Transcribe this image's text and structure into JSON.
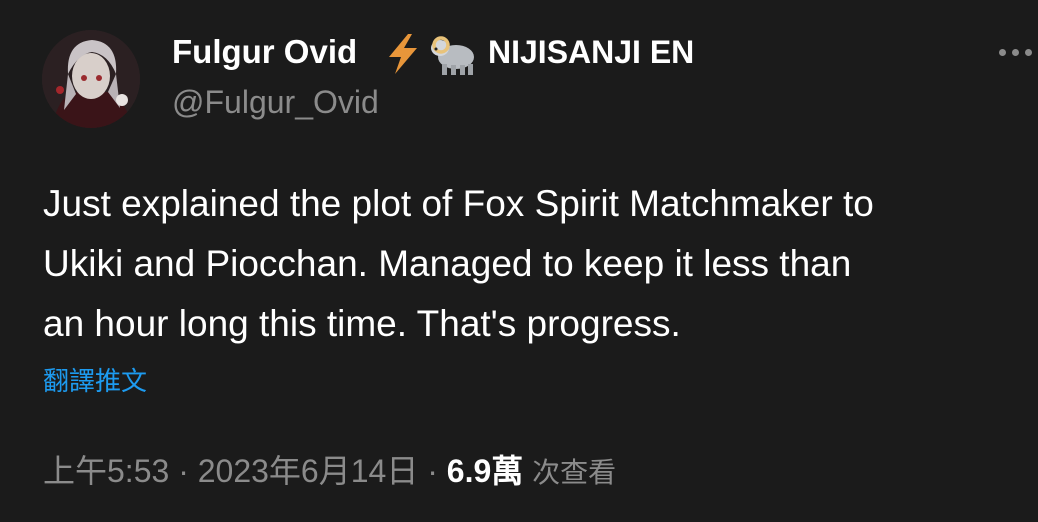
{
  "author": {
    "display_name": "Fulgur Ovid",
    "affiliation": "NIJISANJI EN",
    "handle": "@Fulgur_Ovid",
    "badge_icons": [
      "lightning-bolt",
      "ram"
    ]
  },
  "tweet": {
    "text_lines": [
      "Just explained the plot of Fox Spirit Matchmaker to",
      "Ukiki and Piocchan. Managed to keep it less than",
      "an hour long this time. That's progress."
    ],
    "translate_label": "翻譯推文"
  },
  "meta": {
    "time": "上午5:53",
    "separator": " · ",
    "date": "2023年6月14日",
    "views_count": "6.9萬",
    "views_label": "次查看"
  },
  "colors": {
    "background": "#1b1b1b",
    "text": "#ffffff",
    "secondary": "#8b8b8b",
    "link": "#1d9bf0",
    "bolt": "#e8963a"
  }
}
